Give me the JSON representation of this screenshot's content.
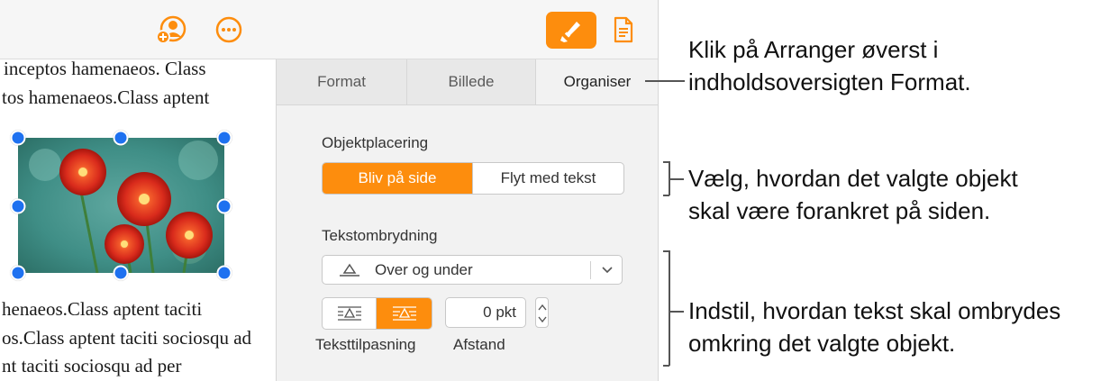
{
  "toolbar": {
    "icons": [
      "add-collaborator-icon",
      "more-icon",
      "format-brush-icon",
      "document-icon"
    ],
    "accent_color": "#fd8d0d"
  },
  "document": {
    "top_lines": [
      "inceptos hamenaeos. Class",
      "tos hamenaeos.Class aptent"
    ],
    "bottom_lines": [
      "henaeos.Class aptent taciti",
      "os.Class aptent taciti sociosqu ad",
      "nt taciti sociosqu ad per"
    ]
  },
  "inspector": {
    "tabs": [
      "Format",
      "Billede",
      "Organiser"
    ],
    "active_tab": "Organiser",
    "object_placement": {
      "label": "Objektplacering",
      "options": [
        "Bliv på side",
        "Flyt med tekst"
      ],
      "selected": "Bliv på side"
    },
    "text_wrap": {
      "label": "Tekstombrydning",
      "selected_value": "Over og under",
      "fit_label": "Teksttilpasning",
      "spacing_label": "Afstand",
      "spacing_value": "0 pkt"
    }
  },
  "callouts": {
    "organise": "Klik på Arranger øverst i\nindholdsoversigten Format.",
    "placement": "Vælg, hvordan det valgte objekt\nskal være forankret på siden.",
    "wrap": "Indstil, hvordan tekst skal ombrydes\nomkring det valgte objekt."
  }
}
